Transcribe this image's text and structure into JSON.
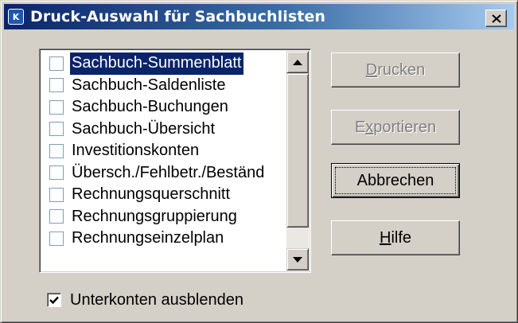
{
  "window": {
    "title": "Druck-Auswahl für Sachbuchlisten",
    "icon": "app-icon",
    "icon_text": "K",
    "close_icon": "close-icon"
  },
  "list": {
    "items": [
      {
        "label": "Sachbuch-Summenblatt",
        "checked": false,
        "selected": true
      },
      {
        "label": "Sachbuch-Saldenliste",
        "checked": false,
        "selected": false
      },
      {
        "label": "Sachbuch-Buchungen",
        "checked": false,
        "selected": false
      },
      {
        "label": "Sachbuch-Übersicht",
        "checked": false,
        "selected": false
      },
      {
        "label": "Investitionskonten",
        "checked": false,
        "selected": false
      },
      {
        "label": "Übersch./Fehlbetr./Beständ",
        "checked": false,
        "selected": false
      },
      {
        "label": "Rechnungsquerschnitt",
        "checked": false,
        "selected": false
      },
      {
        "label": "Rechnungsgruppierung",
        "checked": false,
        "selected": false
      },
      {
        "label": "Rechnungseinzelplan",
        "checked": false,
        "selected": false
      }
    ]
  },
  "buttons": {
    "drucken": {
      "label_underlined": "D",
      "label_rest": "rucken",
      "enabled": false
    },
    "exportieren": {
      "label_prefix": "E",
      "label_underlined": "x",
      "label_rest": "portieren",
      "enabled": false
    },
    "abbrechen": {
      "label": "Abbrechen",
      "enabled": true,
      "default": true
    },
    "hilfe": {
      "label_underlined": "H",
      "label_rest": "ilfe",
      "enabled": true
    }
  },
  "options": {
    "hide_subaccounts": {
      "label": "Unterkonten ausblenden",
      "checked": true
    }
  },
  "colors": {
    "selection": "#0a246a",
    "face": "#d4d0c8"
  }
}
